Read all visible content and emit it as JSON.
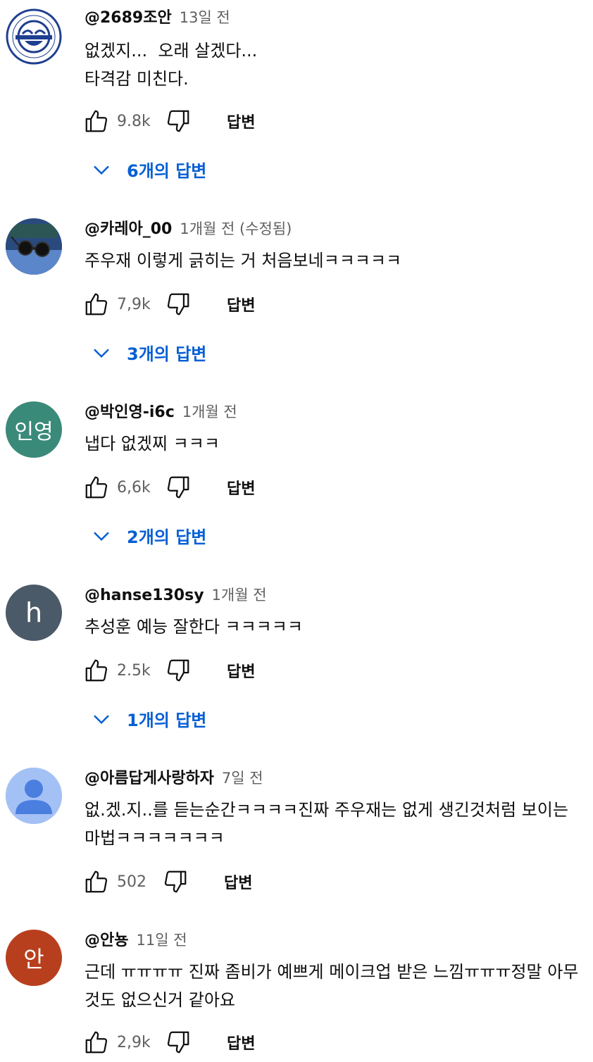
{
  "colors": {
    "link": "#065fd4",
    "meta": "#606060",
    "text": "#0f0f0f"
  },
  "comments": [
    {
      "author": "@2689조안",
      "time": "13일 전",
      "text": "없겠지...  오래 살겠다...\n타격감 미친다.",
      "likes": "9.8k",
      "reply_label": "답변",
      "replies_label": "6개의 답변",
      "avatar": {
        "kind": "logo",
        "text": "",
        "bg": "#ffffff"
      }
    },
    {
      "author": "@카레아_00",
      "time": "1개월 전 (수정됨)",
      "text": "주우재 이렇게 긁히는 거 처음보네ㅋㅋㅋㅋㅋ",
      "likes": "7,9k",
      "reply_label": "답변",
      "replies_label": "3개의 답변",
      "avatar": {
        "kind": "photo",
        "text": "",
        "bg": "#3f63a7"
      }
    },
    {
      "author": "@박인영-i6c",
      "time": "1개월 전",
      "text": "냅다 없겠찌 ㅋㅋㅋ",
      "likes": "6,6k",
      "reply_label": "답변",
      "replies_label": "2개의 답변",
      "avatar": {
        "kind": "initial",
        "text": "인영",
        "bg": "#3a8a7a"
      }
    },
    {
      "author": "@hanse130sy",
      "time": "1개월 전",
      "text": "추성훈 예능 잘한다 ㅋㅋㅋㅋㅋ",
      "likes": "2.5k",
      "reply_label": "답변",
      "replies_label": "1개의 답변",
      "avatar": {
        "kind": "initial",
        "text": "h",
        "bg": "#4b5a68"
      }
    },
    {
      "author": "@아름답게사랑하자",
      "time": "7일 전",
      "text": "없.겠.지..를 듣는순간ㅋㅋㅋㅋ진짜 주우재는 없게 생긴것처럼 보이는 마법ㅋㅋㅋㅋㅋㅋㅋ",
      "likes": "502",
      "reply_label": "답변",
      "replies_label": "",
      "avatar": {
        "kind": "person",
        "text": "",
        "bg": "#a4c1f5"
      }
    },
    {
      "author": "@안뇽",
      "time": "11일 전",
      "text": "근데 ㅠㅠㅠㅠ 진짜 좀비가 예쁘게 메이크업 받은 느낌ㅠㅠㅠ정말 아무것도 없으신거 같아요",
      "likes": "2,9k",
      "reply_label": "답변",
      "replies_label": "",
      "avatar": {
        "kind": "initial",
        "text": "안",
        "bg": "#b83f1e"
      }
    }
  ]
}
